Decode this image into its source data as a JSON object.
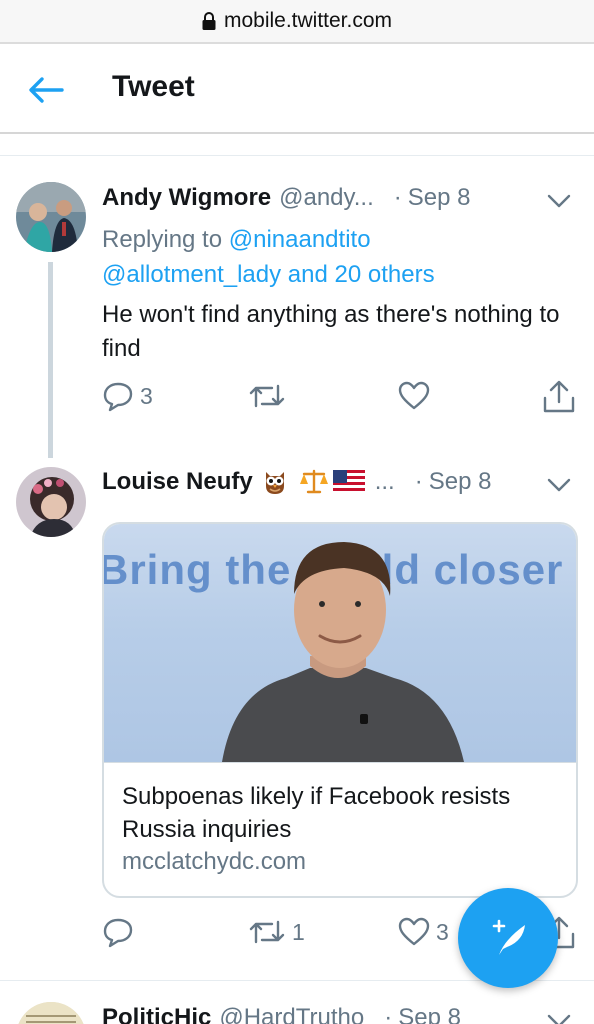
{
  "browser": {
    "url": "mobile.twitter.com",
    "lock_icon": "lock-icon"
  },
  "header": {
    "title": "Tweet",
    "back_icon": "arrow-left-icon"
  },
  "colors": {
    "accent": "#1da1f2",
    "text": "#14171a",
    "secondary": "#657786",
    "divider": "#e6ecf0"
  },
  "tweets": [
    {
      "name": "Andy Wigmore",
      "handle": "@andy...",
      "dot": "·",
      "date": "Sep 8",
      "replying_prefix": "Replying to ",
      "replying_user": "@ninaandtito",
      "replying_others": "@allotment_lady and 20 others",
      "text": "He won't find anything as there's nothing to find",
      "reply_count": "3",
      "retweet_count": "",
      "like_count": ""
    },
    {
      "name": "Louise Neufy",
      "handle_suffix": "...",
      "dot": "·",
      "date": "Sep 8",
      "emojis": [
        "owl",
        "balance-scale",
        "us-flag"
      ],
      "card": {
        "image_text": "Bring the world closer",
        "title": "Subpoenas likely if Facebook resists Russia inquiries",
        "domain": "mcclatchydc.com"
      },
      "reply_count": "",
      "retweet_count": "1",
      "like_count": "3"
    },
    {
      "name": "PoliticHic",
      "handle": "@HardTrutho",
      "dot": "·",
      "date": "Sep 8"
    }
  ],
  "fab": {
    "label": "compose-tweet",
    "icon": "feather-plus-icon"
  }
}
